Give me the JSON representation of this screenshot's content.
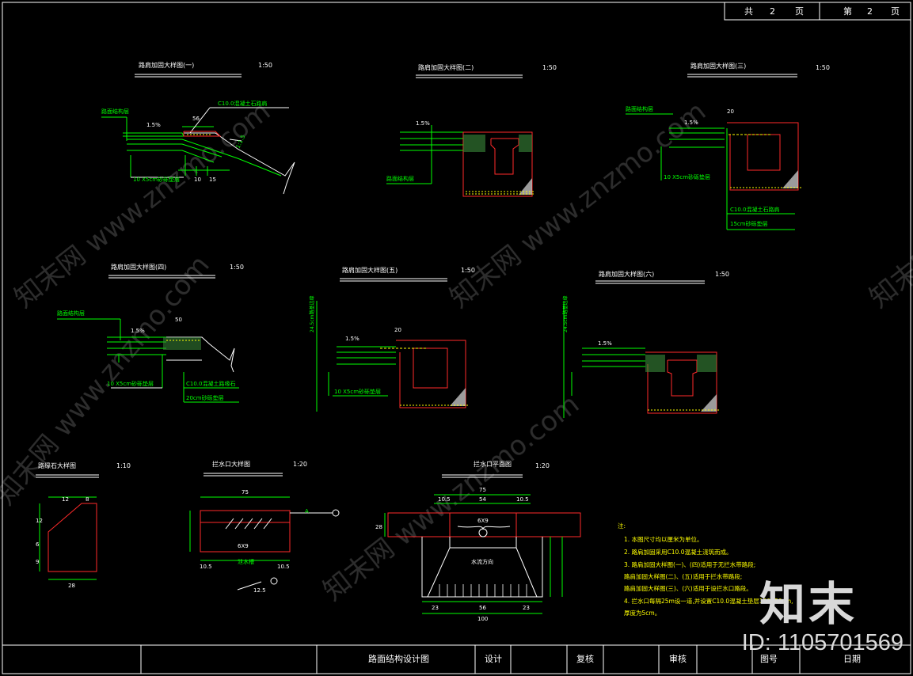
{
  "header": {
    "total_label": "共",
    "total_pages": "2",
    "total_unit": "页",
    "page_label": "第",
    "page_num": "2",
    "page_unit": "页"
  },
  "details": [
    {
      "title": "路肩加固大样图(一)",
      "scale": "1:50"
    },
    {
      "title": "路肩加固大样图(二)",
      "scale": "1:50"
    },
    {
      "title": "路肩加固大样图(三)",
      "scale": "1:50"
    },
    {
      "title": "路肩加固大样图(四)",
      "scale": "1:50"
    },
    {
      "title": "路肩加固大样图(五)",
      "scale": "1:50"
    },
    {
      "title": "路肩加固大样图(六)",
      "scale": "1:50"
    },
    {
      "title": "路缘石大样图",
      "scale": "1:10"
    },
    {
      "title": "拦水口大样图",
      "scale": "1:20"
    },
    {
      "title": "拦水口平面图",
      "scale": "1:20"
    }
  ],
  "labels": {
    "slope": "1.5%",
    "c10": "C10.0混凝土石路肩",
    "road_layer": "路面结构层",
    "base10": "10 X5cm砂砾垫层",
    "curb_mat": "C10.0混凝土路缘石",
    "sand15": "15cm砂砾垫层",
    "sand20": "20cm砂砾垫层",
    "water": "水流方向",
    "grate": "泄水槽",
    "grid": "6X9",
    "a": "A",
    "side": "24.5cm路基边缘"
  },
  "dims": {
    "d56": "56",
    "d10": "10",
    "d15": "15",
    "d50": "50",
    "d20": "20",
    "d26": "26",
    "d12": "12",
    "d8": "8",
    "d6": "6",
    "d9": "9",
    "d28": "28",
    "d75": "75",
    "d105": "10.5",
    "d54": "54",
    "d23": "23",
    "d100": "100",
    "d125": "12.5"
  },
  "notes": {
    "heading": "注:",
    "items": [
      "1. 本图尺寸均以厘米为单位。",
      "2. 路肩加固采用C10.0混凝土浇筑而成。",
      "3. 路肩加固大样图(一)、(四)适用于无拦水带路段;",
      "   路肩加固大样图(二)、(五)适用于拦水带路段;",
      "   路肩加固大样图(三)、(六)适用于设拦水口路段。",
      "4. 拦水口每隔25m设一道,并设置C10.0混凝土垫层100X50cm,",
      "   厚度为5cm。"
    ]
  },
  "title_block": {
    "drawing_title": "路面结构设计图",
    "design": "设计",
    "review": "复核",
    "audit": "审核",
    "drawing_no": "图号",
    "date": "日期"
  },
  "watermark": {
    "text": "知末网 www.znzmo.com",
    "brand": "知末",
    "id": "ID: 1105701569"
  },
  "colors": {
    "background": "#000000",
    "lines": "#ffffff",
    "red": "#ff2a2a",
    "green": "#00ff00",
    "yellow": "#ffff00"
  }
}
